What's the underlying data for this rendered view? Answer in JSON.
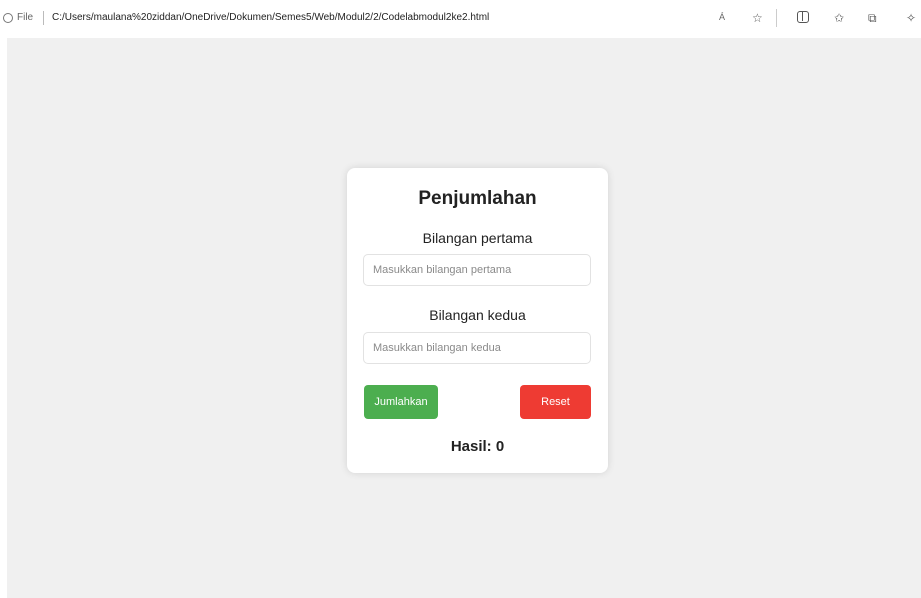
{
  "browser": {
    "protocol": "File",
    "url": "C:/Users/maulana%20ziddan/OneDrive/Dokumen/Semes5/Web/Modul2/2/Codelabmodul2ke2.html",
    "read_aloud_label": "Á"
  },
  "form": {
    "title": "Penjumlahan",
    "first_label": "Bilangan pertama",
    "first_placeholder": "Masukkan bilangan pertama",
    "first_value": "",
    "second_label": "Bilangan kedua",
    "second_placeholder": "Masukkan bilangan kedua",
    "second_value": "",
    "add_button": "Jumlahkan",
    "reset_button": "Reset",
    "result_label": "Hasil:",
    "result_value": "0"
  },
  "colors": {
    "add_button": "#4cae4f",
    "reset_button": "#ee3b33",
    "page_background": "#f0f0f0"
  },
  "icons": [
    "info-icon",
    "favorite-star-icon",
    "split-screen-icon",
    "favorites-icon",
    "collections-icon",
    "extensions-icon"
  ]
}
